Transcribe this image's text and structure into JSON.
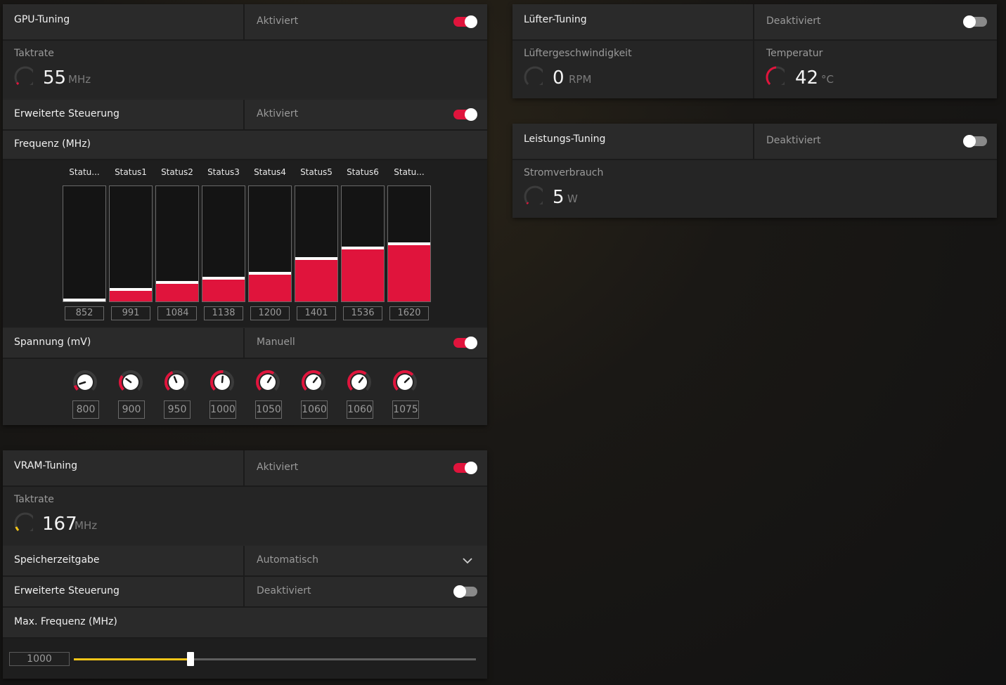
{
  "colors": {
    "accent": "#e0143c",
    "vram_accent": "#f5c518",
    "panel": "#262626"
  },
  "gpu": {
    "title": "GPU-Tuning",
    "status": "Aktiviert",
    "toggle_on": true,
    "clock_label": "Taktrate",
    "clock_value": "55",
    "clock_unit": "MHz",
    "clock_gauge_level": 0.03,
    "advanced_label": "Erweiterte Steuerung",
    "advanced_status": "Aktiviert",
    "advanced_on": true,
    "freq_label": "Frequenz (MHz)",
    "freq_states": [
      {
        "label": "Statu...",
        "value": "852",
        "level": 0.0
      },
      {
        "label": "Status1",
        "value": "991",
        "level": 0.09
      },
      {
        "label": "Status2",
        "value": "1084",
        "level": 0.15
      },
      {
        "label": "Status3",
        "value": "1138",
        "level": 0.19
      },
      {
        "label": "Status4",
        "value": "1200",
        "level": 0.23
      },
      {
        "label": "Status5",
        "value": "1401",
        "level": 0.36
      },
      {
        "label": "Status6",
        "value": "1536",
        "level": 0.45
      },
      {
        "label": "Statu...",
        "value": "1620",
        "level": 0.49
      }
    ],
    "voltage_label": "Spannung (mV)",
    "voltage_mode": "Manuell",
    "voltage_on": true,
    "voltages": [
      {
        "value": "800",
        "level": 0.1
      },
      {
        "value": "900",
        "level": 0.3
      },
      {
        "value": "950",
        "level": 0.42
      },
      {
        "value": "1000",
        "level": 0.52
      },
      {
        "value": "1050",
        "level": 0.62
      },
      {
        "value": "1060",
        "level": 0.64
      },
      {
        "value": "1060",
        "level": 0.64
      },
      {
        "value": "1075",
        "level": 0.67
      }
    ]
  },
  "vram": {
    "title": "VRAM-Tuning",
    "status": "Aktiviert",
    "toggle_on": true,
    "clock_label": "Taktrate",
    "clock_value": "167",
    "clock_unit": "MHz",
    "clock_gauge_level": 0.08,
    "timing_label": "Speicherzeitgabe",
    "timing_value": "Automatisch",
    "advanced_label": "Erweiterte Steuerung",
    "advanced_status": "Deaktiviert",
    "advanced_on": false,
    "max_freq_label": "Max. Frequenz (MHz)",
    "max_freq_value": "1000",
    "max_freq_level": 0.29
  },
  "fan": {
    "title": "Lüfter-Tuning",
    "status": "Deaktiviert",
    "toggle_on": false,
    "speed_label": "Lüftergeschwindigkeit",
    "speed_value": "0",
    "speed_unit": "RPM",
    "speed_gauge_level": 0.0,
    "temp_label": "Temperatur",
    "temp_value": "42",
    "temp_unit": "°C",
    "temp_gauge_level": 0.45
  },
  "power": {
    "title": "Leistungs-Tuning",
    "status": "Deaktiviert",
    "toggle_on": false,
    "usage_label": "Stromverbrauch",
    "usage_value": "5",
    "usage_unit": "W",
    "usage_gauge_level": 0.02
  }
}
